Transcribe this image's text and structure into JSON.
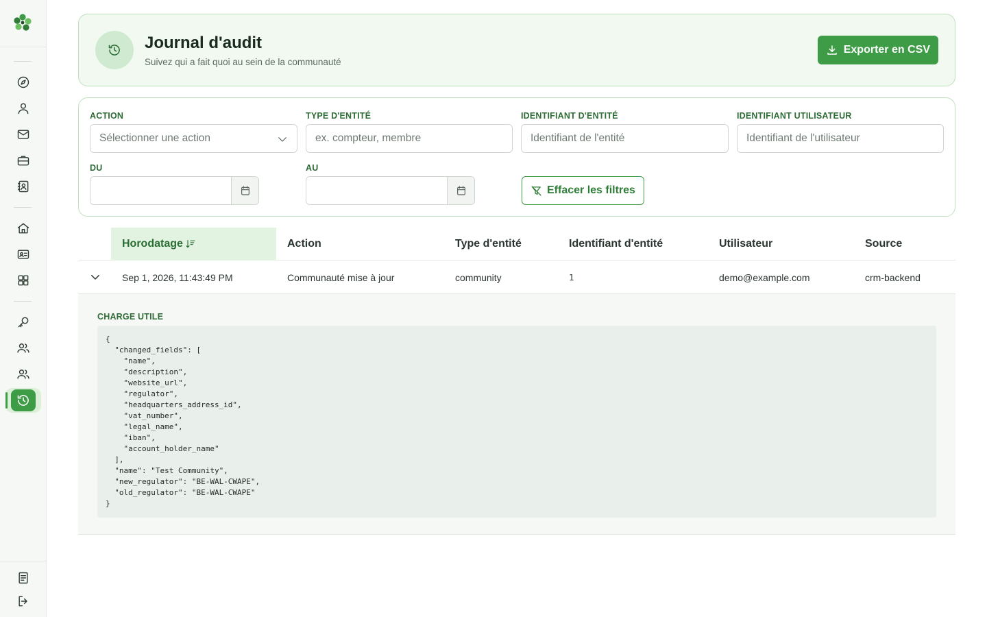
{
  "header": {
    "title": "Journal d'audit",
    "subtitle": "Suivez qui a fait quoi au sein de la communauté",
    "export_label": "Exporter en CSV"
  },
  "filters": {
    "action": {
      "label": "ACTION",
      "placeholder": "Sélectionner une action"
    },
    "entity_type": {
      "label": "TYPE D'ENTITÉ",
      "placeholder": "ex. compteur, membre"
    },
    "entity_id": {
      "label": "IDENTIFIANT D'ENTITÉ",
      "placeholder": "Identifiant de l'entité"
    },
    "user_id": {
      "label": "IDENTIFIANT UTILISATEUR",
      "placeholder": "Identifiant de l'utilisateur"
    },
    "from": {
      "label": "DU",
      "value": ""
    },
    "to": {
      "label": "AU",
      "value": ""
    },
    "clear_label": "Effacer les filtres"
  },
  "table": {
    "columns": [
      "Horodatage",
      "Action",
      "Type d'entité",
      "Identifiant d'entité",
      "Utilisateur",
      "Source"
    ],
    "sorted_column": "Horodatage",
    "rows": [
      {
        "timestamp": "Sep 1, 2026, 11:43:49 PM",
        "action": "Communauté mise à jour",
        "entity_type": "community",
        "entity_id": "1",
        "user": "demo@example.com",
        "source": "crm-backend",
        "expanded": true,
        "payload_label": "CHARGE UTILE",
        "payload": "{\n  \"changed_fields\": [\n    \"name\",\n    \"description\",\n    \"website_url\",\n    \"regulator\",\n    \"headquarters_address_id\",\n    \"vat_number\",\n    \"legal_name\",\n    \"iban\",\n    \"account_holder_name\"\n  ],\n  \"name\": \"Test Community\",\n  \"new_regulator\": \"BE-WAL-CWAPE\",\n  \"old_regulator\": \"BE-WAL-CWAPE\"\n}"
      }
    ]
  },
  "sidebar": {
    "icons": [
      "compass-icon",
      "user-icon",
      "mail-icon",
      "briefcase-icon",
      "contacts-icon",
      "home-icon",
      "id-card-icon",
      "grid-icon",
      "key-icon",
      "users-icon",
      "team-icon",
      "history-icon",
      "document-icon",
      "logout-icon"
    ],
    "active": "history-icon"
  },
  "colors": {
    "accent": "#3d9c45",
    "accent_light": "#e3f3e2",
    "border": "#bfe0bf"
  }
}
